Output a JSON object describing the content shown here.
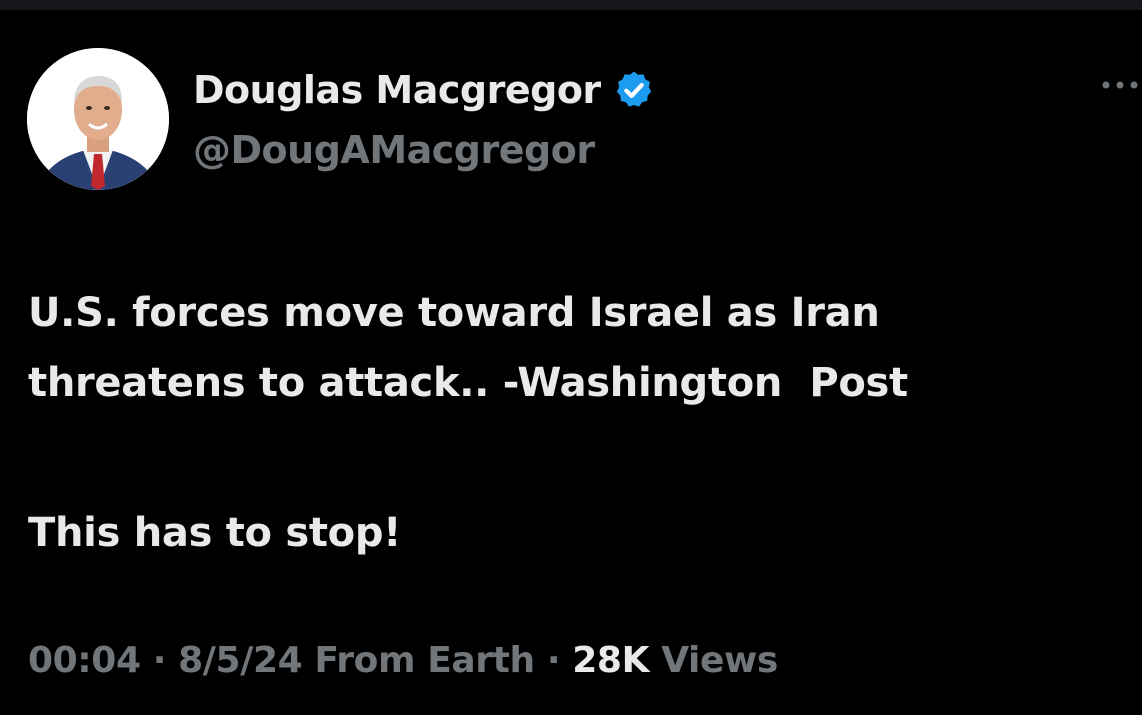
{
  "author": {
    "display_name": "Douglas Macgregor",
    "handle": "@DougAMacgregor",
    "verified": true,
    "verified_color": "#1d9bf0",
    "avatar_icon": "profile-photo"
  },
  "more_icon": "more-horizontal-icon",
  "tweet": {
    "text_line_1": "U.S. forces move toward Israel as Iran",
    "text_line_2": "threatens to attack.. -Washington  Post",
    "text_paragraph_2": "This has to stop!"
  },
  "meta": {
    "time": "00:04",
    "separator": "·",
    "date": "8/5/24",
    "source": "From Earth",
    "views_count": "28K",
    "views_label": "Views"
  },
  "colors": {
    "background": "#000000",
    "primary_text": "#e7e9ea",
    "secondary_text": "#71767b"
  }
}
